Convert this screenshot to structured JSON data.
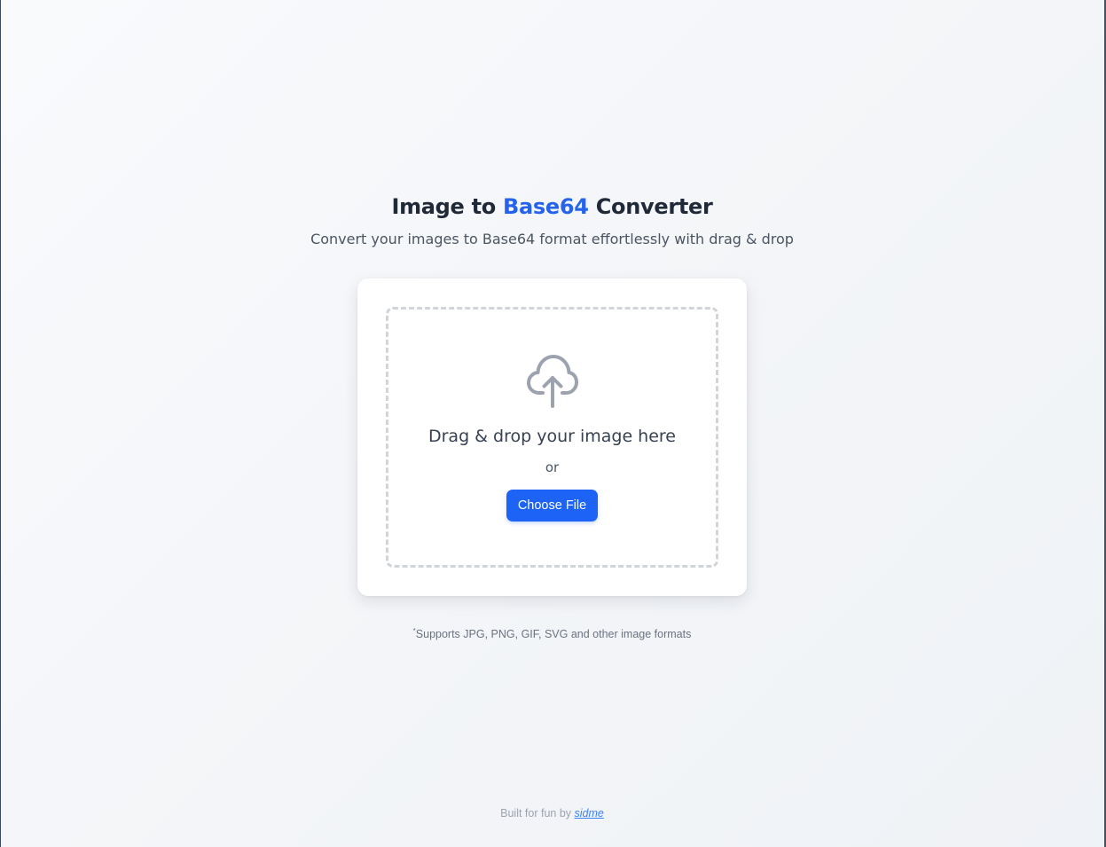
{
  "header": {
    "title_prefix": "Image to ",
    "title_accent": "Base64",
    "title_suffix": " Converter",
    "subtitle": "Convert your images to Base64 format effortlessly with drag & drop"
  },
  "dropzone": {
    "icon": "cloud-upload-icon",
    "title": "Drag & drop your image here",
    "or_label": "or",
    "button_label": "Choose File"
  },
  "note": {
    "marker": "*",
    "text": "Supports JPG, PNG, GIF, SVG and other image formats"
  },
  "footer": {
    "prefix": "Built for fun by ",
    "link_label": "sidme"
  },
  "colors": {
    "accent": "#2563eb",
    "button": "#1d63f5",
    "heading": "#1f2937",
    "dashed_border": "#d1d5db"
  }
}
